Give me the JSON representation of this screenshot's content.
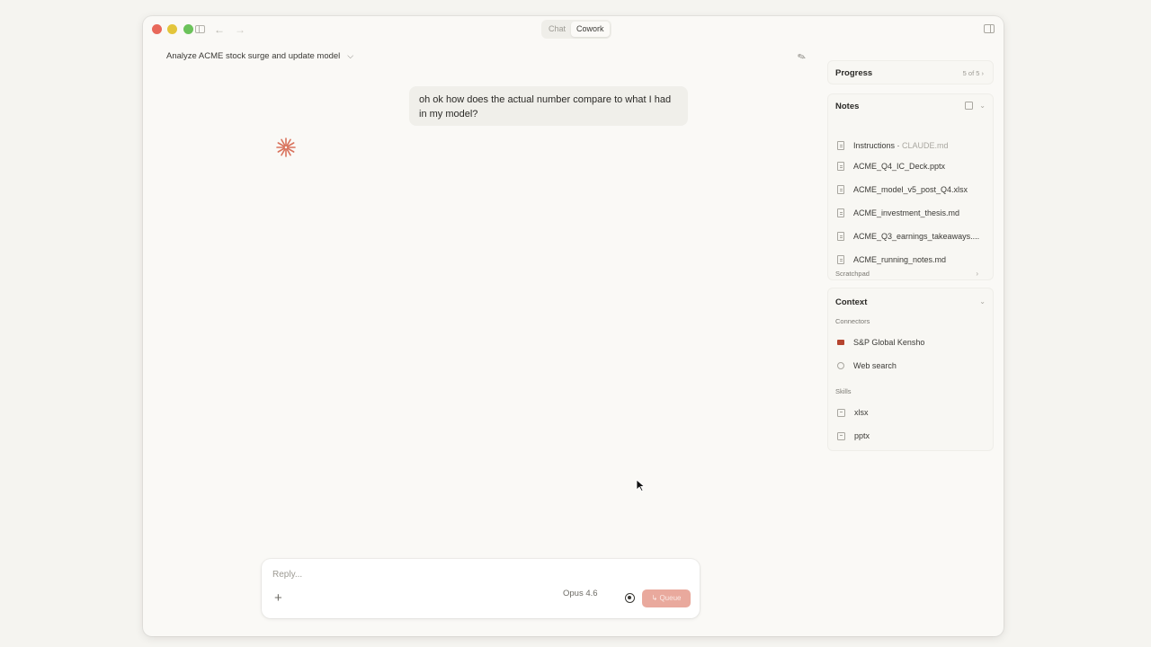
{
  "titlebar": {
    "tabs": [
      {
        "label": "Chat",
        "active": false
      },
      {
        "label": "Cowork",
        "active": true
      }
    ]
  },
  "conversation": {
    "title": "Analyze ACME stock surge and update model",
    "user_message": "oh ok how does the actual number compare to what I had in my model?"
  },
  "composer": {
    "placeholder": "Reply...",
    "model": "Opus 4.6",
    "queue_label": "Queue"
  },
  "panel": {
    "progress": {
      "title": "Progress",
      "count": "5 of 5"
    },
    "notes": {
      "title": "Notes",
      "instructions": {
        "label": "Instructions",
        "file": "CLAUDE.md"
      },
      "files": [
        "ACME_Q4_IC_Deck.pptx",
        "ACME_model_v5_post_Q4.xlsx",
        "ACME_investment_thesis.md",
        "ACME_Q3_earnings_takeaways....",
        "ACME_running_notes.md"
      ],
      "scratchpad": "Scratchpad"
    },
    "context": {
      "title": "Context",
      "connectors_label": "Connectors",
      "connectors": [
        "S&P Global Kensho",
        "Web search"
      ],
      "skills_label": "Skills",
      "skills": [
        "xlsx",
        "pptx"
      ]
    }
  },
  "colors": {
    "accent": "#e9a99d",
    "spark": "#d9735d",
    "background": "#faf9f6"
  }
}
